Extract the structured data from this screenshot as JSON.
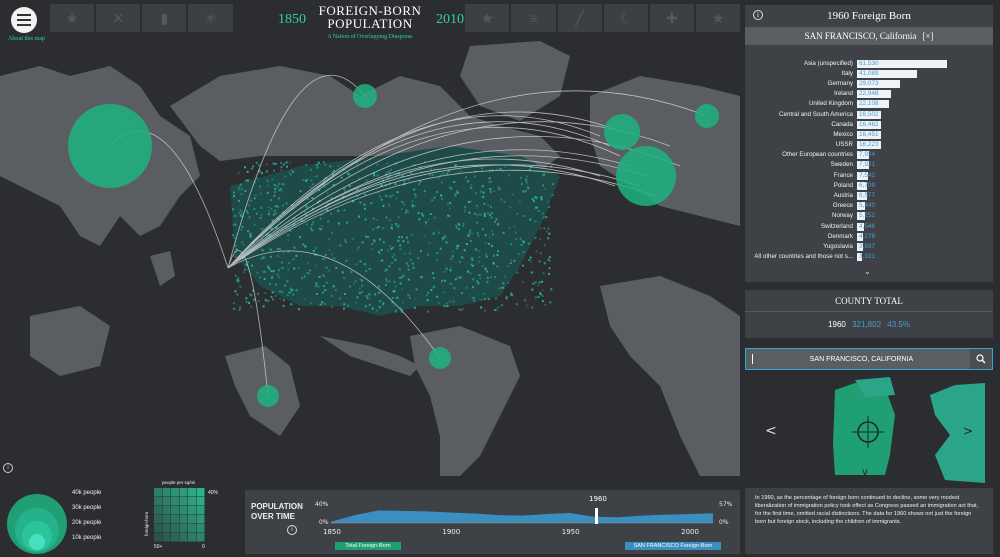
{
  "header": {
    "title_line1": "FOREIGN-BORN",
    "title_line2": "POPULATION",
    "subtitle": "A Nation of Overlapping Diasporas",
    "year_start": "1850",
    "year_end": "2010",
    "about_link": "About this map",
    "flags": [
      "flag-1",
      "flag-2",
      "flag-3",
      "flag-4",
      "flag-5",
      "flag-6",
      "flag-7",
      "flag-8",
      "flag-9",
      "flag-10",
      "flag-11",
      "flag-12",
      "flag-13",
      "flag-14",
      "flag-15"
    ]
  },
  "panel": {
    "header": "1960 Foreign Born",
    "location": "SAN FRANCISCO, California",
    "close_label": "[×]",
    "rows": [
      {
        "label": "Asia (unspecified)",
        "value": "61,530",
        "n": 61530
      },
      {
        "label": "Italy",
        "value": "41,089",
        "n": 41089
      },
      {
        "label": "Germany",
        "value": "29,073",
        "n": 29073
      },
      {
        "label": "Ireland",
        "value": "22,948",
        "n": 22948
      },
      {
        "label": "United Kingdom",
        "value": "22,108",
        "n": 22108
      },
      {
        "label": "Central and South America",
        "value": "16,502",
        "n": 16502
      },
      {
        "label": "Canada",
        "value": "16,462",
        "n": 16462
      },
      {
        "label": "Mexico",
        "value": "16,451",
        "n": 16451
      },
      {
        "label": "USSR",
        "value": "16,223",
        "n": 16223
      },
      {
        "label": "Other European countries",
        "value": "7,924",
        "n": 7924
      },
      {
        "label": "Sweden",
        "value": "7,921",
        "n": 7921
      },
      {
        "label": "France",
        "value": "7,542",
        "n": 7542
      },
      {
        "label": "Poland",
        "value": "6,709",
        "n": 6709
      },
      {
        "label": "Austria",
        "value": "6,577",
        "n": 6577
      },
      {
        "label": "Greece",
        "value": "5,440",
        "n": 5440
      },
      {
        "label": "Norway",
        "value": "5,252",
        "n": 5252
      },
      {
        "label": "Switzerland",
        "value": "4,546",
        "n": 4546
      },
      {
        "label": "Denmark",
        "value": "4,278",
        "n": 4278
      },
      {
        "label": "Yugoslavia",
        "value": "3,937",
        "n": 3937
      },
      {
        "label": "All other countries and those not s...",
        "value": "3,331",
        "n": 3331
      }
    ],
    "county_total_header": "COUNTY TOTAL",
    "county_year": "1960",
    "county_total": "321,802",
    "county_pct": "43.5%",
    "search_value": "SAN FRANCISCO, CALIFORNIA",
    "description": "In 1960, as the percentage of foreign born continued to decline, some very modest liberalization of immigration policy took effect as Congress passed an immigration act that, for the first time, omitted racial distinctions. The data for 1960 shows not just the foreign born but foreign stock, including the children of immigrants."
  },
  "legend": {
    "circle_labels": [
      "40k people",
      "30k people",
      "20k people",
      "10k people"
    ],
    "grid_title": "people per sq/mi",
    "grid_ylabel": "foreign-born",
    "grid_top_right": "40%",
    "grid_bottom_right": "0",
    "grid_bottom_left": "50+"
  },
  "timeline": {
    "label_line1": "POPULATION",
    "label_line2": "OVER TIME",
    "y_left_top": "40%",
    "y_left_bottom": "0%",
    "y_right_top": "57%",
    "y_right_bottom": "0%",
    "ticks": [
      "1850",
      "1900",
      "1950",
      "2000"
    ],
    "selected_year": "1960",
    "legend_total": "Total Foreign-Born",
    "legend_county": "SAN FRANCISCO Foreign-Born",
    "colors": {
      "total": "#1f9f73",
      "county": "#3a8fbf"
    },
    "county_series": [
      5,
      30,
      48,
      46,
      44,
      40,
      36,
      30,
      28,
      34,
      38,
      24,
      22,
      28,
      32,
      34,
      37
    ]
  },
  "colors": {
    "accent": "#2fd1a0",
    "bar": "#eef3f7",
    "value": "#4a9fcf",
    "panel": "#3e4146",
    "land": "#5a5d62"
  }
}
